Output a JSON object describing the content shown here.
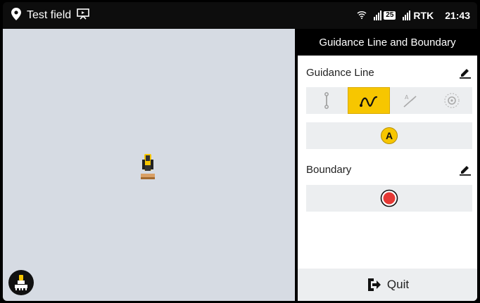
{
  "status_bar": {
    "field_name": "Test field",
    "satellite_count": "25",
    "correction": "RTK",
    "time": "21:43"
  },
  "panel": {
    "title": "Guidance Line and Boundary",
    "guidance_line_label": "Guidance Line",
    "boundary_label": "Boundary",
    "point_a_label": "A",
    "quit_label": "Quit",
    "modes": [
      "straight-line",
      "curve",
      "a-plus-heading",
      "pivot"
    ],
    "active_mode": "curve"
  },
  "colors": {
    "accent": "#f7c600",
    "record": "#e53935",
    "map_bg": "#d6dbe3"
  }
}
